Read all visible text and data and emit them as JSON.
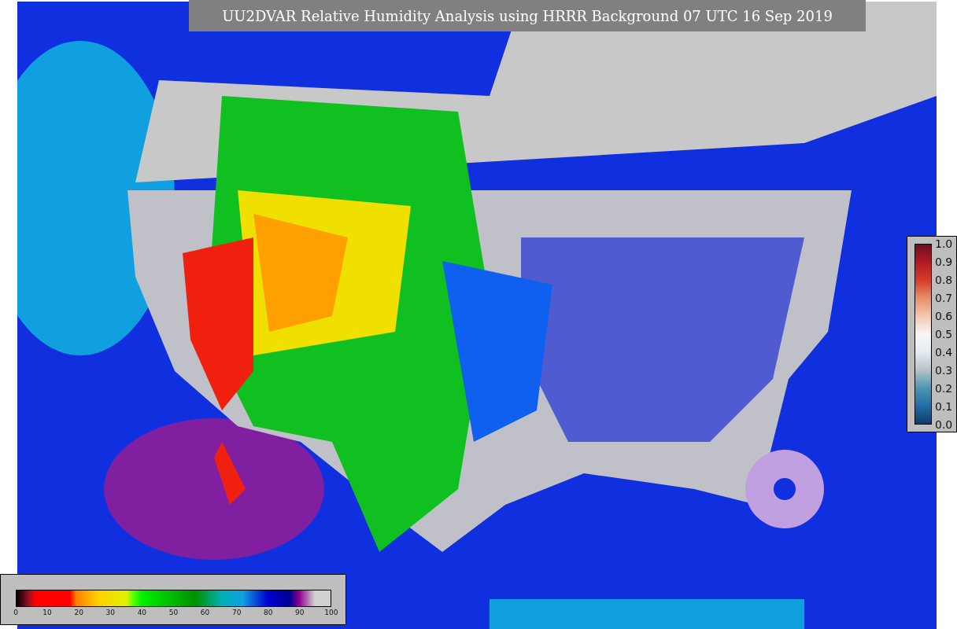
{
  "title": "UU2DVAR Relative Humidity Analysis using HRRR Background 07 UTC 16 Sep 2019",
  "colorbar_right": {
    "ticks": [
      "1.0",
      "0.9",
      "0.8",
      "0.7",
      "0.6",
      "0.5",
      "0.4",
      "0.3",
      "0.2",
      "0.1",
      "0.0"
    ]
  },
  "colorbar_bottom": {
    "ticks": [
      "0",
      "10",
      "20",
      "30",
      "40",
      "50",
      "60",
      "70",
      "80",
      "90",
      "100"
    ]
  }
}
